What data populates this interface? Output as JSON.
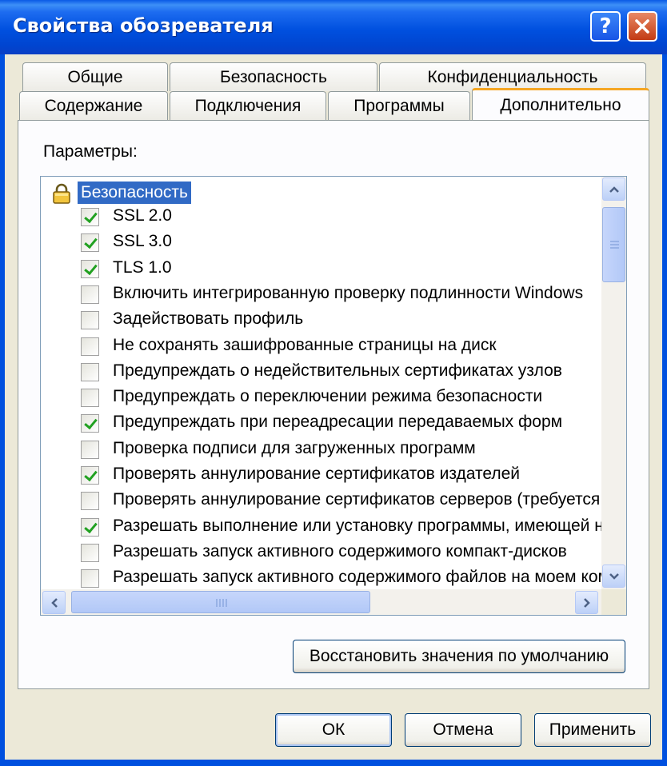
{
  "window": {
    "title": "Свойства обозревателя",
    "help_label": "?"
  },
  "tabs": {
    "row1": [
      "Общие",
      "Безопасность",
      "Конфиденциальность"
    ],
    "row2": [
      "Содержание",
      "Подключения",
      "Программы",
      "Дополнительно"
    ],
    "active": "Дополнительно"
  },
  "settings": {
    "label": "Параметры:",
    "category": "Безопасность",
    "items": [
      {
        "label": "SSL 2.0",
        "checked": true
      },
      {
        "label": "SSL 3.0",
        "checked": true
      },
      {
        "label": "TLS 1.0",
        "checked": true
      },
      {
        "label": "Включить интегрированную проверку подлинности Windows",
        "checked": false
      },
      {
        "label": "Задействовать профиль",
        "checked": false
      },
      {
        "label": "Не сохранять зашифрованные страницы на диск",
        "checked": false
      },
      {
        "label": "Предупреждать о недействительных сертификатах узлов",
        "checked": false
      },
      {
        "label": "Предупреждать о переключении режима безопасности",
        "checked": false
      },
      {
        "label": "Предупреждать при переадресации передаваемых форм",
        "checked": true
      },
      {
        "label": "Проверка подписи для загруженных программ",
        "checked": false
      },
      {
        "label": "Проверять аннулирование сертификатов издателей",
        "checked": true
      },
      {
        "label": "Проверять аннулирование сертификатов серверов (требуется перезапуск)",
        "checked": false
      },
      {
        "label": "Разрешать выполнение или установку программы, имеющей недопустимую подпись",
        "checked": true
      },
      {
        "label": "Разрешать запуск активного содержимого компакт-дисков",
        "checked": false
      },
      {
        "label": "Разрешать запуск активного содержимого файлов на моем компьютере",
        "checked": false
      }
    ]
  },
  "buttons": {
    "restore": "Восстановить значения по умолчанию",
    "ok": "ОК",
    "cancel": "Отмена",
    "apply": "Применить"
  }
}
